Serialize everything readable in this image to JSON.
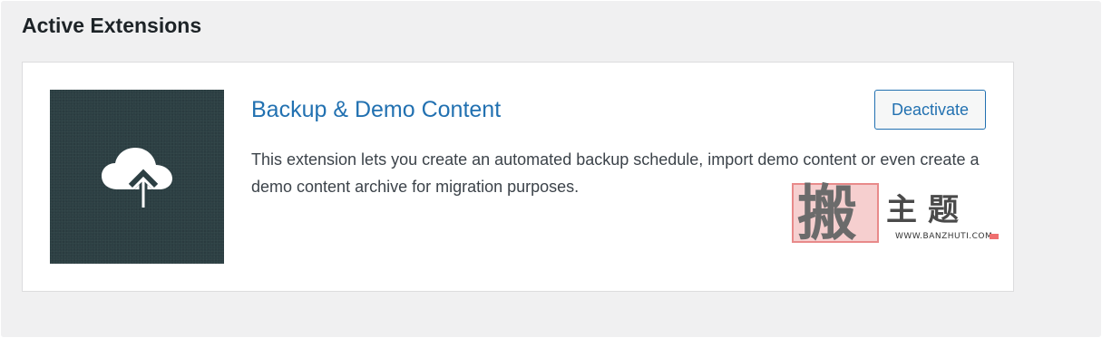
{
  "section": {
    "title": "Active Extensions"
  },
  "extension": {
    "title": "Backup & Demo Content",
    "description": "This extension lets you create an automated backup schedule, import demo content or even create a demo content archive for migration purposes.",
    "deactivate_label": "Deactivate",
    "thumbnail_icon": "cloud-upload-icon"
  },
  "watermark": {
    "seal_char": "搬",
    "chars": "主题",
    "site": "WWW.BANZHUTI.COM"
  },
  "colors": {
    "link": "#2271b1",
    "thumbnail_bg": "#2c3f43",
    "panel_bg": "#f0f0f1"
  }
}
